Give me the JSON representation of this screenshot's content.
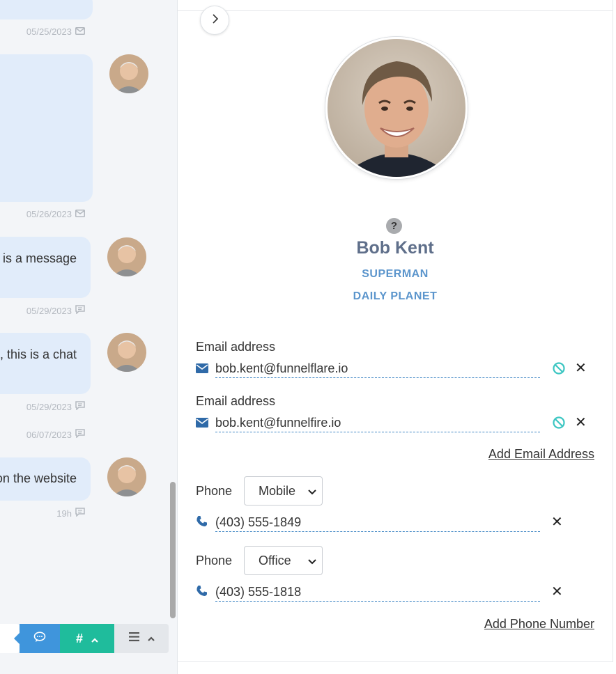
{
  "conversation": {
    "messages": [
      {
        "date": "05/25/2023",
        "channel": "email-icon"
      },
      {
        "text": "",
        "date": "05/26/2023",
        "channel": "email-icon"
      },
      {
        "text": "s is a message",
        "date": "05/29/2023",
        "channel": "chat-icon"
      },
      {
        "text": ", this is a chat",
        "date": "05/29/2023",
        "channel": "chat-icon"
      },
      {
        "date": "06/07/2023",
        "channel": "chat-icon"
      },
      {
        "text": "on the website",
        "date": "19h",
        "channel": "chat-icon"
      }
    ]
  },
  "composer": {
    "hash_label": "#"
  },
  "contact": {
    "name": "Bob Kent",
    "status_badge": "?",
    "title": "SUPERMAN",
    "company": "DAILY PLANET",
    "emails": [
      {
        "label": "Email address",
        "value": "bob.kent@funnelflare.io"
      },
      {
        "label": "Email address",
        "value": "bob.kent@funnelfire.io"
      }
    ],
    "add_email_label": "Add Email Address",
    "phones": [
      {
        "label": "Phone",
        "type": "Mobile",
        "value": "(403) 555-1849"
      },
      {
        "label": "Phone",
        "type": "Office",
        "value": "(403) 555-1818"
      }
    ],
    "add_phone_label": "Add Phone Number",
    "remove_symbol": "✕"
  },
  "colors": {
    "accent_blue": "#3f95dc",
    "accent_teal": "#1fbc9c",
    "bubble": "#e1ecfa",
    "name_color": "#5f6f8a",
    "subtitle_color": "#5b95cc"
  }
}
